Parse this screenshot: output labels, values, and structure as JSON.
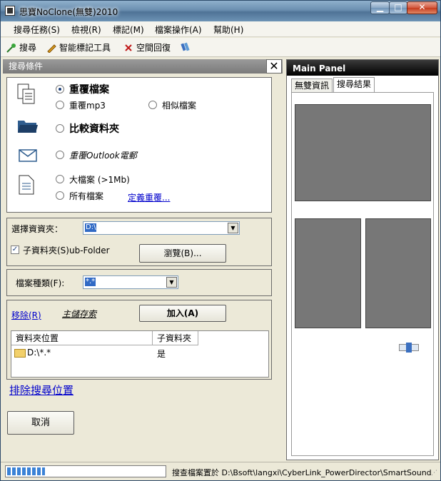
{
  "window": {
    "title": "思寶NoClone(無雙)2010",
    "min": "▁",
    "max": "□",
    "close": "✕"
  },
  "menu": [
    "搜尋任務(S)",
    "檢視(R)",
    "標記(M)",
    "檔案操作(A)",
    "幫助(H)"
  ],
  "toolbar": {
    "search": "搜尋",
    "smart_mark": "智能標記工具",
    "space_recover": "空間回復"
  },
  "left": {
    "header": "搜尋條件",
    "close": "✕",
    "options": {
      "dup_files": "重覆檔案",
      "dup_mp3": "重覆mp3",
      "similar_files": "相似檔案",
      "compare_folder": "比較資料夾",
      "dup_outlook": "重覆Outlook電郵",
      "large_files": "大檔案 (>1Mb)",
      "all_files": "所有檔案",
      "define_dup": "定義重覆..."
    },
    "folder": {
      "label": "選擇資資夾：",
      "value": "D:\\",
      "subfolder": "子資料夾(S)ub-Folder",
      "subfolder_checked": true,
      "browse": "瀏覽(B)..."
    },
    "filetype": {
      "label": "檔案種類(F):",
      "value": "*.*"
    },
    "locations": {
      "remove": "移除(R)",
      "master": "主儲存索",
      "add": "加入(A)",
      "columns": [
        "資料夾位置",
        "子資料夾"
      ],
      "rows": [
        {
          "path": "D:\\*.*",
          "sub": "是"
        }
      ]
    },
    "exclude": "排除搜尋位置",
    "cancel": "取消"
  },
  "right": {
    "header": "Main Panel",
    "tabs": [
      "無雙資訊",
      "搜尋結果"
    ]
  },
  "status": {
    "progress": 0.24,
    "text": "搜查檔案置於 D:\\Bsoft\\langxi\\CyberLink_PowerDirector\\SmartSound"
  }
}
